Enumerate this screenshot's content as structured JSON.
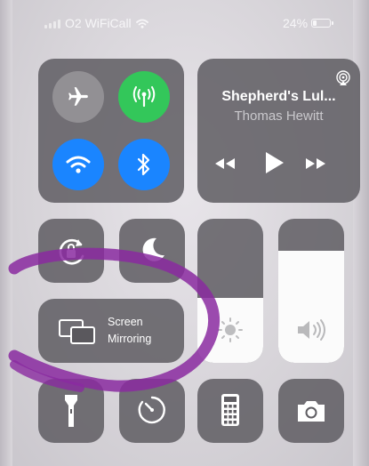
{
  "status_bar": {
    "carrier": "O2 WiFiCall",
    "battery": "24%",
    "battery_level": 0.24
  },
  "connectivity": {
    "airplane": {
      "icon": "airplane-icon",
      "active": false
    },
    "cellular": {
      "icon": "cellular-antenna-icon",
      "active": true
    },
    "wifi": {
      "icon": "wifi-icon",
      "active": true
    },
    "bluetooth": {
      "icon": "bluetooth-icon",
      "active": true
    }
  },
  "now_playing": {
    "title": "Shepherd's Lul...",
    "artist": "Thomas Hewitt",
    "airplay_icon": "airplay-icon",
    "controls": [
      "rewind-icon",
      "play-icon",
      "fast-forward-icon"
    ]
  },
  "toggles": {
    "rotation_lock": {
      "icon": "rotation-lock-icon"
    },
    "do_not_disturb": {
      "icon": "moon-icon"
    }
  },
  "screen_mirroring": {
    "line1": "Screen",
    "line2": "Mirroring",
    "icon": "screen-mirroring-icon"
  },
  "sliders": {
    "brightness": {
      "icon": "sun-icon",
      "level": 0.45
    },
    "volume": {
      "icon": "speaker-icon",
      "level": 0.78
    }
  },
  "bottom_row": [
    "flashlight-icon",
    "timer-icon",
    "calculator-icon",
    "camera-icon"
  ],
  "colors": {
    "green": "#33c75a",
    "blue": "#1a85ff",
    "tile": "#626065",
    "annotation": "#8a2aa0"
  }
}
